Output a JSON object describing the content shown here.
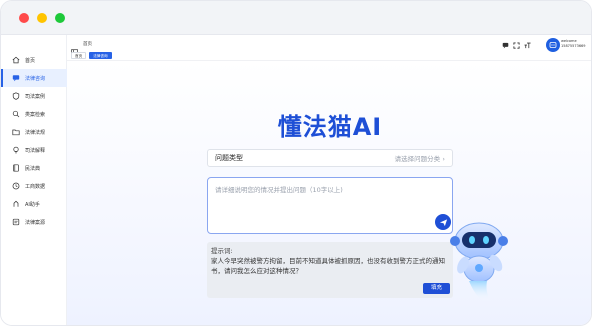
{
  "sidebar": {
    "items": [
      {
        "label": "首页",
        "icon": "home-icon"
      },
      {
        "label": "法律咨询",
        "icon": "chat-icon",
        "active": true
      },
      {
        "label": "司法案例",
        "icon": "shield-icon"
      },
      {
        "label": "类案检索",
        "icon": "search-icon"
      },
      {
        "label": "法律法规",
        "icon": "folder-icon"
      },
      {
        "label": "司法解释",
        "icon": "bulb-icon"
      },
      {
        "label": "民法典",
        "icon": "book-icon"
      },
      {
        "label": "工商数据",
        "icon": "building-icon"
      },
      {
        "label": "AI助手",
        "icon": "robot-icon"
      },
      {
        "label": "法律案源",
        "icon": "document-icon"
      }
    ]
  },
  "header": {
    "breadcrumb": "首页",
    "tabs": [
      {
        "label": "首页"
      },
      {
        "label": "法律咨询",
        "active": true
      }
    ],
    "user": {
      "greeting": "welcome",
      "phone": "15875573669"
    }
  },
  "main": {
    "title": "懂法猫AI",
    "select": {
      "label": "问题类型",
      "placeholder": "请选择问题分类"
    },
    "question_placeholder": "请详细说明您的情况并提出问题（10字以上)",
    "hint": {
      "title": "提示词:",
      "text": "家人今早突然被警方拘留，目前不知道具体被抓原因，也没有收到警方正式的通知书，请问我怎么应对这种情况？"
    },
    "fill_button": "填充"
  },
  "colors": {
    "accent": "#1f4fd6",
    "title": "#1e4fd6",
    "active_bg": "#e8f0ff"
  }
}
